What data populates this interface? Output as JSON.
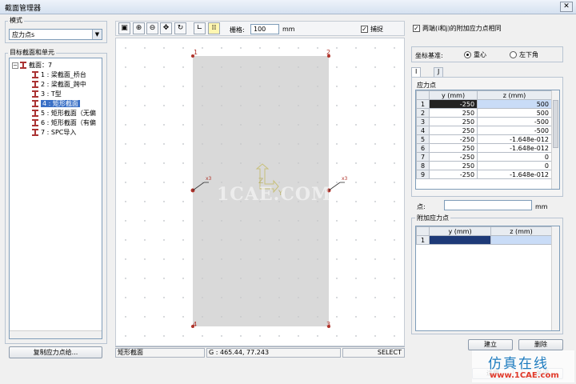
{
  "window": {
    "title": "截面管理器",
    "close": "✕"
  },
  "left": {
    "mode_group": "模式",
    "mode_value": "应力点s",
    "target_group": "目标截面和单元",
    "tree_root": "截面：7",
    "tree_items": [
      "1 : 梁截面_桥台",
      "2 : 梁截面_跨中",
      "3 : T型",
      "4 : 矩形截面",
      "5 : 矩形截面（无偏",
      "6 : 矩形截面（有偏",
      "7 : SPC导入"
    ],
    "selected_index": 3,
    "copy_button": "复制应力点给..."
  },
  "toolbar": {
    "grid_label": "栅格:",
    "grid_value": "100",
    "grid_unit": "mm",
    "snap_label": "捕捉",
    "snap_checked": true
  },
  "canvas": {
    "points": [
      "1",
      "2",
      "3",
      "4"
    ],
    "side_marker": "x3",
    "axis_z": "Z",
    "axis_y": "Y"
  },
  "status": {
    "section": "矩形截面",
    "coords": "G : 465.44, 77.243",
    "mode": "SELECT"
  },
  "right": {
    "same_ends_label": "两端(i和j)的附加应力点相同",
    "same_ends_checked": true,
    "coord_group": "坐标基准:",
    "opt_centroid": "重心",
    "opt_corner": "左下角",
    "tabs": [
      "I",
      "J"
    ],
    "stress_group": "应力点",
    "col_y": "y (mm)",
    "col_z": "z (mm)",
    "rows": [
      [
        "1",
        "-250",
        "500"
      ],
      [
        "2",
        "250",
        "500"
      ],
      [
        "3",
        "250",
        "-500"
      ],
      [
        "4",
        "250",
        "-500"
      ],
      [
        "5",
        "-250",
        "-1.648e-012"
      ],
      [
        "6",
        "250",
        "-1.648e-012"
      ],
      [
        "7",
        "-250",
        "0"
      ],
      [
        "8",
        "250",
        "0"
      ],
      [
        "9",
        "-250",
        "-1.648e-012"
      ]
    ],
    "point_label": "点:",
    "point_unit": "mm",
    "extra_group": "附加应力点",
    "extra_rows": [
      [
        "1",
        "",
        ""
      ]
    ],
    "btn_create": "建立",
    "btn_delete": "删除",
    "btn_apply": "适用",
    "btn_close": "关闭"
  },
  "watermark": {
    "line1": "仿真在线",
    "line2": "www.1CAE.com",
    "center": "1CAE.COM"
  }
}
